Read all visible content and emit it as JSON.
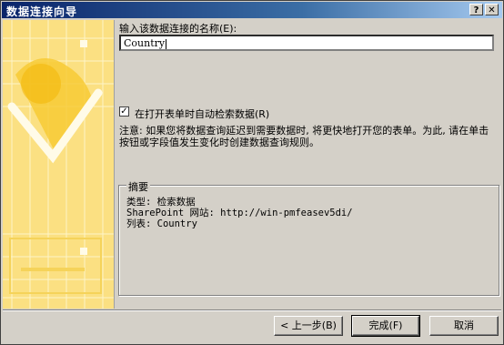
{
  "window": {
    "title": "数据连接向导",
    "help_label": "?",
    "close_label": "✕"
  },
  "form": {
    "name_label": "输入该数据连接的名称(E):",
    "name_value": "Country",
    "auto_retrieve_label": "在打开表单时自动检索数据(R)",
    "auto_retrieve_checked": true,
    "note_line1": "注意: 如果您将数据查询延迟到需要数据时, 将更快地打开您的表单。为此, 请在单击",
    "note_line2": "按钮或字段值发生变化时创建数据查询规则。"
  },
  "summary": {
    "legend": "摘要",
    "type_line": "类型: 检索数据",
    "site_line": "SharePoint 网站: http://win-pmfeasev5di/",
    "list_line": "列表: Country"
  },
  "buttons": {
    "back": "< 上一步(B)",
    "finish": "完成(F)",
    "cancel": "取消"
  },
  "colors": {
    "art_bg": "#fbe082",
    "art_accent": "#f5c518",
    "titlebar": "#0a246a"
  }
}
